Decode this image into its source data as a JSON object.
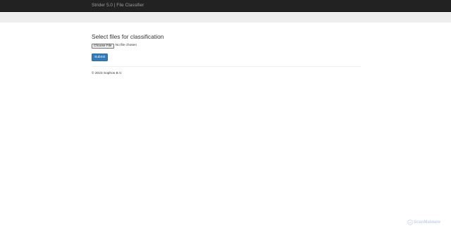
{
  "navbar": {
    "brand": "Strider 5.0 | File Classifier"
  },
  "main": {
    "heading": "Select files for classification",
    "file_input": {
      "button_label": "Choose File",
      "status": "No file chosen"
    },
    "submit_label": "Submit"
  },
  "footer": {
    "copyright": "© 2023 Sophos B.V."
  },
  "watermark": {
    "text": "ScanMalware"
  },
  "colors": {
    "navbar_bg": "#222222",
    "navbar_text": "#9d9d9d",
    "jumbotron_bg": "#eeeeee",
    "primary": "#337ab7"
  }
}
